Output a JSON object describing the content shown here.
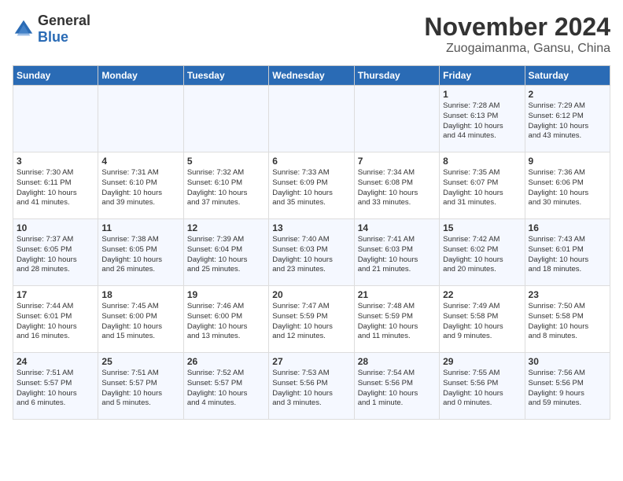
{
  "logo": {
    "general": "General",
    "blue": "Blue"
  },
  "header": {
    "month": "November 2024",
    "location": "Zuogaimanma, Gansu, China"
  },
  "days_of_week": [
    "Sunday",
    "Monday",
    "Tuesday",
    "Wednesday",
    "Thursday",
    "Friday",
    "Saturday"
  ],
  "weeks": [
    [
      {
        "day": "",
        "info": ""
      },
      {
        "day": "",
        "info": ""
      },
      {
        "day": "",
        "info": ""
      },
      {
        "day": "",
        "info": ""
      },
      {
        "day": "",
        "info": ""
      },
      {
        "day": "1",
        "info": "Sunrise: 7:28 AM\nSunset: 6:13 PM\nDaylight: 10 hours\nand 44 minutes."
      },
      {
        "day": "2",
        "info": "Sunrise: 7:29 AM\nSunset: 6:12 PM\nDaylight: 10 hours\nand 43 minutes."
      }
    ],
    [
      {
        "day": "3",
        "info": "Sunrise: 7:30 AM\nSunset: 6:11 PM\nDaylight: 10 hours\nand 41 minutes."
      },
      {
        "day": "4",
        "info": "Sunrise: 7:31 AM\nSunset: 6:10 PM\nDaylight: 10 hours\nand 39 minutes."
      },
      {
        "day": "5",
        "info": "Sunrise: 7:32 AM\nSunset: 6:10 PM\nDaylight: 10 hours\nand 37 minutes."
      },
      {
        "day": "6",
        "info": "Sunrise: 7:33 AM\nSunset: 6:09 PM\nDaylight: 10 hours\nand 35 minutes."
      },
      {
        "day": "7",
        "info": "Sunrise: 7:34 AM\nSunset: 6:08 PM\nDaylight: 10 hours\nand 33 minutes."
      },
      {
        "day": "8",
        "info": "Sunrise: 7:35 AM\nSunset: 6:07 PM\nDaylight: 10 hours\nand 31 minutes."
      },
      {
        "day": "9",
        "info": "Sunrise: 7:36 AM\nSunset: 6:06 PM\nDaylight: 10 hours\nand 30 minutes."
      }
    ],
    [
      {
        "day": "10",
        "info": "Sunrise: 7:37 AM\nSunset: 6:05 PM\nDaylight: 10 hours\nand 28 minutes."
      },
      {
        "day": "11",
        "info": "Sunrise: 7:38 AM\nSunset: 6:05 PM\nDaylight: 10 hours\nand 26 minutes."
      },
      {
        "day": "12",
        "info": "Sunrise: 7:39 AM\nSunset: 6:04 PM\nDaylight: 10 hours\nand 25 minutes."
      },
      {
        "day": "13",
        "info": "Sunrise: 7:40 AM\nSunset: 6:03 PM\nDaylight: 10 hours\nand 23 minutes."
      },
      {
        "day": "14",
        "info": "Sunrise: 7:41 AM\nSunset: 6:03 PM\nDaylight: 10 hours\nand 21 minutes."
      },
      {
        "day": "15",
        "info": "Sunrise: 7:42 AM\nSunset: 6:02 PM\nDaylight: 10 hours\nand 20 minutes."
      },
      {
        "day": "16",
        "info": "Sunrise: 7:43 AM\nSunset: 6:01 PM\nDaylight: 10 hours\nand 18 minutes."
      }
    ],
    [
      {
        "day": "17",
        "info": "Sunrise: 7:44 AM\nSunset: 6:01 PM\nDaylight: 10 hours\nand 16 minutes."
      },
      {
        "day": "18",
        "info": "Sunrise: 7:45 AM\nSunset: 6:00 PM\nDaylight: 10 hours\nand 15 minutes."
      },
      {
        "day": "19",
        "info": "Sunrise: 7:46 AM\nSunset: 6:00 PM\nDaylight: 10 hours\nand 13 minutes."
      },
      {
        "day": "20",
        "info": "Sunrise: 7:47 AM\nSunset: 5:59 PM\nDaylight: 10 hours\nand 12 minutes."
      },
      {
        "day": "21",
        "info": "Sunrise: 7:48 AM\nSunset: 5:59 PM\nDaylight: 10 hours\nand 11 minutes."
      },
      {
        "day": "22",
        "info": "Sunrise: 7:49 AM\nSunset: 5:58 PM\nDaylight: 10 hours\nand 9 minutes."
      },
      {
        "day": "23",
        "info": "Sunrise: 7:50 AM\nSunset: 5:58 PM\nDaylight: 10 hours\nand 8 minutes."
      }
    ],
    [
      {
        "day": "24",
        "info": "Sunrise: 7:51 AM\nSunset: 5:57 PM\nDaylight: 10 hours\nand 6 minutes."
      },
      {
        "day": "25",
        "info": "Sunrise: 7:51 AM\nSunset: 5:57 PM\nDaylight: 10 hours\nand 5 minutes."
      },
      {
        "day": "26",
        "info": "Sunrise: 7:52 AM\nSunset: 5:57 PM\nDaylight: 10 hours\nand 4 minutes."
      },
      {
        "day": "27",
        "info": "Sunrise: 7:53 AM\nSunset: 5:56 PM\nDaylight: 10 hours\nand 3 minutes."
      },
      {
        "day": "28",
        "info": "Sunrise: 7:54 AM\nSunset: 5:56 PM\nDaylight: 10 hours\nand 1 minute."
      },
      {
        "day": "29",
        "info": "Sunrise: 7:55 AM\nSunset: 5:56 PM\nDaylight: 10 hours\nand 0 minutes."
      },
      {
        "day": "30",
        "info": "Sunrise: 7:56 AM\nSunset: 5:56 PM\nDaylight: 9 hours\nand 59 minutes."
      }
    ]
  ]
}
